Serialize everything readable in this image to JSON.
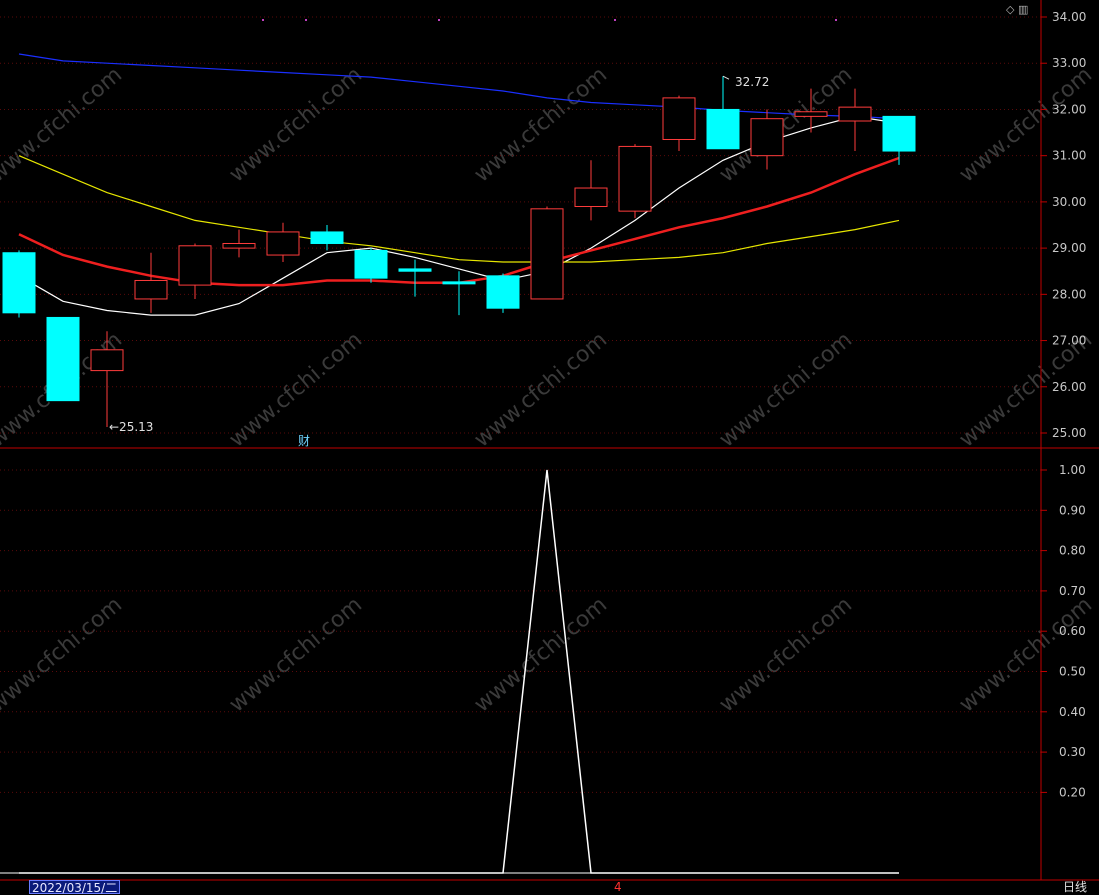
{
  "chart_data": [
    {
      "type": "candlestick",
      "title": "",
      "ylim": [
        24.7,
        34.3
      ],
      "y_ticks": [
        "34.00",
        "33.00",
        "32.00",
        "31.00",
        "30.00",
        "29.00",
        "28.00",
        "27.00",
        "26.00",
        "25.00"
      ],
      "grid": true,
      "candles": [
        {
          "open": 28.9,
          "close": 27.6,
          "high": 28.95,
          "low": 27.5
        },
        {
          "open": 27.5,
          "close": 25.7,
          "high": 27.5,
          "low": 25.7
        },
        {
          "open": 26.35,
          "close": 26.8,
          "high": 27.2,
          "low": 25.13
        },
        {
          "open": 27.9,
          "close": 28.3,
          "high": 28.9,
          "low": 27.6
        },
        {
          "open": 28.2,
          "close": 29.05,
          "high": 29.1,
          "low": 27.9
        },
        {
          "open": 29.0,
          "close": 29.1,
          "high": 29.4,
          "low": 28.8
        },
        {
          "open": 28.85,
          "close": 29.35,
          "high": 29.55,
          "low": 28.7
        },
        {
          "open": 29.35,
          "close": 29.1,
          "high": 29.5,
          "low": 28.95
        },
        {
          "open": 28.95,
          "close": 28.35,
          "high": 29.0,
          "low": 28.25
        },
        {
          "open": 28.55,
          "close": 28.5,
          "high": 28.75,
          "low": 27.95
        },
        {
          "open": 28.27,
          "close": 28.24,
          "high": 28.5,
          "low": 27.55
        },
        {
          "open": 28.4,
          "close": 27.7,
          "high": 28.45,
          "low": 27.6
        },
        {
          "open": 27.9,
          "close": 29.85,
          "high": 29.9,
          "low": 27.9
        },
        {
          "open": 29.9,
          "close": 30.3,
          "high": 30.9,
          "low": 29.6
        },
        {
          "open": 29.8,
          "close": 31.2,
          "high": 31.25,
          "low": 29.65
        },
        {
          "open": 31.35,
          "close": 32.25,
          "high": 32.3,
          "low": 31.1
        },
        {
          "open": 32.0,
          "close": 31.15,
          "high": 32.72,
          "low": 31.15
        },
        {
          "open": 31.0,
          "close": 31.8,
          "high": 32.0,
          "low": 30.7
        },
        {
          "open": 31.85,
          "close": 31.95,
          "high": 32.45,
          "low": 31.5
        },
        {
          "open": 31.75,
          "close": 32.05,
          "high": 32.45,
          "low": 31.1
        },
        {
          "open": 31.85,
          "close": 31.1,
          "high": 31.85,
          "low": 30.8
        }
      ],
      "series": [
        {
          "name": "",
          "color": "#ffffff",
          "values": [
            28.4,
            27.85,
            27.65,
            27.55,
            27.55,
            27.8,
            28.35,
            28.9,
            29.0,
            28.8,
            28.55,
            28.3,
            28.5,
            29.0,
            29.6,
            30.3,
            30.9,
            31.3,
            31.6,
            31.85,
            31.7
          ]
        },
        {
          "name": "",
          "color": "#ee1f1f",
          "values": [
            29.3,
            28.85,
            28.6,
            28.4,
            28.25,
            28.2,
            28.2,
            28.3,
            28.3,
            28.25,
            28.25,
            28.4,
            28.7,
            28.95,
            29.2,
            29.45,
            29.65,
            29.9,
            30.2,
            30.6,
            30.95
          ]
        },
        {
          "name": "",
          "color": "#e6e600",
          "values": [
            31.0,
            30.6,
            30.2,
            29.9,
            29.6,
            29.45,
            29.3,
            29.15,
            29.05,
            28.9,
            28.75,
            28.7,
            28.7,
            28.7,
            28.75,
            28.8,
            28.9,
            29.1,
            29.25,
            29.4,
            29.6
          ]
        },
        {
          "name": "",
          "color": "#1a2fff",
          "values": [
            33.2,
            33.05,
            33.0,
            32.95,
            32.9,
            32.85,
            32.8,
            32.75,
            32.7,
            32.6,
            32.5,
            32.4,
            32.25,
            32.15,
            32.1,
            32.05,
            31.98,
            31.93,
            31.88,
            31.85,
            31.8
          ]
        }
      ],
      "annotations": [
        "25.13",
        "32.72"
      ]
    },
    {
      "type": "line",
      "title": "",
      "ylim": [
        0,
        1.05
      ],
      "y_ticks": [
        "1.00",
        "0.90",
        "0.80",
        "0.70",
        "0.60",
        "0.50",
        "0.40",
        "0.30",
        "0.20"
      ],
      "grid": true,
      "series": [
        {
          "name": "",
          "color": "#ffffff",
          "values": [
            0,
            0,
            0,
            0,
            0,
            0,
            0,
            0,
            0,
            0,
            0,
            0,
            1,
            0,
            0,
            0,
            0,
            0,
            0,
            0,
            0
          ]
        }
      ]
    }
  ],
  "footer": {
    "date_label": "2022/03/15/二",
    "period_label": "日线",
    "marker_label": "4"
  },
  "flags": {
    "cai_label": "财"
  },
  "watermark": "www.cfchi.com"
}
